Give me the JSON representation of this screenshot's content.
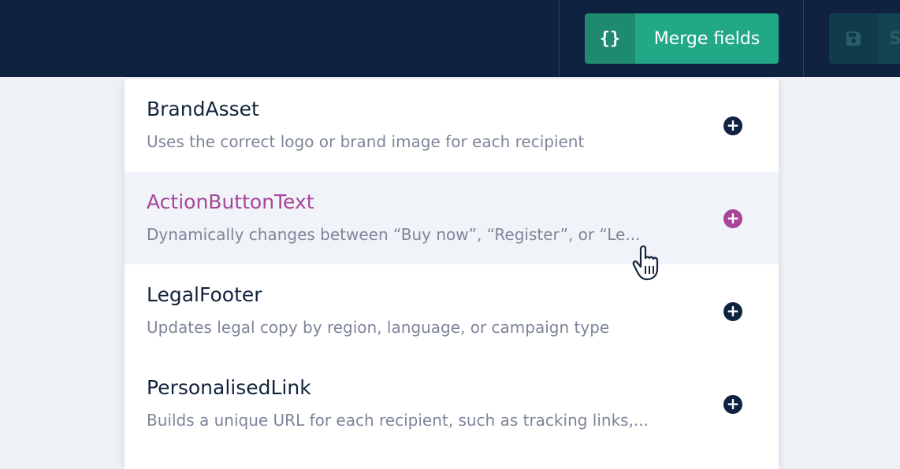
{
  "toolbar": {
    "merge_icon": "{}",
    "merge_label": "Merge fields",
    "save_icon": "save-icon",
    "save_partial_label": "S"
  },
  "colors": {
    "topbar": "#0f2340",
    "merge_button": "#23a887",
    "hover_accent": "#a8459a",
    "hover_row": "#f0f3f8"
  },
  "merge_fields": [
    {
      "name": "BrandAsset",
      "description": "Uses the correct logo or brand image for each recipient",
      "hovered": false
    },
    {
      "name": "ActionButtonText",
      "description": "Dynamically changes between “Buy now”, “Register”, or “Le...",
      "hovered": true
    },
    {
      "name": "LegalFooter",
      "description": "Updates legal copy by region, language, or campaign type",
      "hovered": false
    },
    {
      "name": "PersonalisedLink",
      "description": "Builds a unique URL for each recipient, such as tracking links,...",
      "hovered": false
    }
  ],
  "add_symbol": "+"
}
